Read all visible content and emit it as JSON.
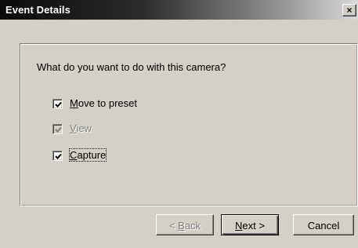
{
  "window": {
    "title": "Event Details",
    "close_label": "×"
  },
  "main": {
    "question": "What do you want to do with this camera?",
    "options": [
      {
        "mnemonic": "M",
        "rest": "ove to preset",
        "checked": true,
        "enabled": true
      },
      {
        "mnemonic": "V",
        "rest": "iew",
        "checked": true,
        "enabled": false
      },
      {
        "mnemonic": "C",
        "rest": "apture",
        "checked": true,
        "enabled": true
      }
    ]
  },
  "buttons": {
    "back": {
      "prefix": "< ",
      "mnemonic": "B",
      "rest": "ack",
      "enabled": false
    },
    "next": {
      "mnemonic": "N",
      "rest": "ext >",
      "enabled": true
    },
    "cancel": {
      "label": "Cancel",
      "enabled": true
    }
  }
}
